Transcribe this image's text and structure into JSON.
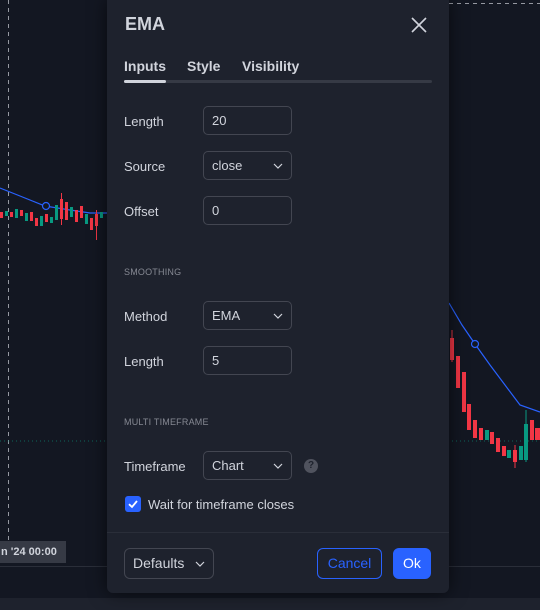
{
  "dialog": {
    "title": "EMA",
    "tabs": [
      {
        "label": "Inputs",
        "active": true
      },
      {
        "label": "Style",
        "active": false
      },
      {
        "label": "Visibility",
        "active": false
      }
    ]
  },
  "inputs": {
    "length": {
      "label": "Length",
      "value": "20"
    },
    "source": {
      "label": "Source",
      "value": "close"
    },
    "offset": {
      "label": "Offset",
      "value": "0"
    }
  },
  "smoothing": {
    "section_title": "SMOOTHING",
    "method": {
      "label": "Method",
      "value": "EMA"
    },
    "length": {
      "label": "Length",
      "value": "5"
    }
  },
  "multi_timeframe": {
    "section_title": "MULTI TIMEFRAME",
    "timeframe": {
      "label": "Timeframe",
      "value": "Chart"
    },
    "wait_for_close": {
      "label": "Wait for timeframe closes",
      "checked": true
    },
    "help_icon": "?"
  },
  "footer": {
    "defaults_label": "Defaults",
    "cancel_label": "Cancel",
    "ok_label": "Ok"
  },
  "chart": {
    "time_label": "n '24   00:00"
  },
  "colors": {
    "background": "#131722",
    "dialog": "#1e222d",
    "accent": "#2962ff",
    "text": "#d1d4dc",
    "candle_up": "#089981",
    "candle_down": "#f23645",
    "ema_line": "#2962ff"
  }
}
